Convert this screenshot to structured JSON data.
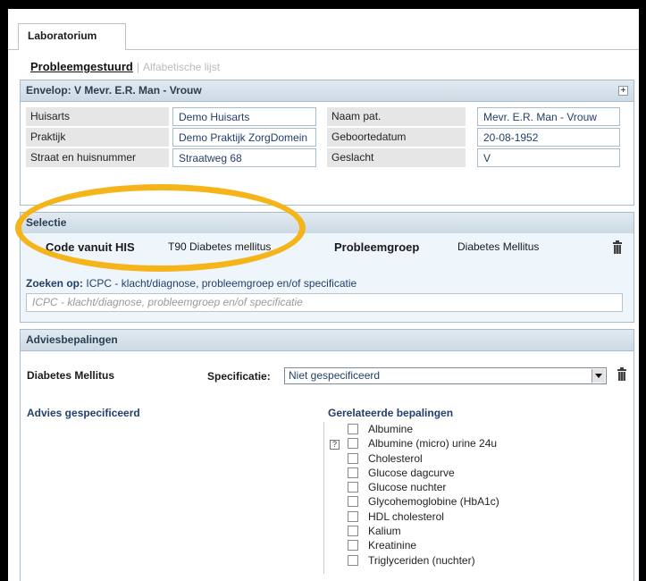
{
  "tab": {
    "label": "Laboratorium"
  },
  "subnav": {
    "active": "Probleemgestuurd",
    "separator": "|",
    "inactive": "Alfabetische lijst"
  },
  "envelop": {
    "title": "Envelop: V Mevr. E.R. Man - Vrouw",
    "fields": [
      {
        "label": "Huisarts",
        "value": "Demo Huisarts"
      },
      {
        "label": "Praktijk",
        "value": "Demo Praktijk ZorgDomein"
      },
      {
        "label": "Straat en huisnummer",
        "value": "Straatweg 68"
      },
      {
        "label": "Naam pat.",
        "value": "Mevr. E.R. Man - Vrouw"
      },
      {
        "label": "Geboortedatum",
        "value": "20-08-1952"
      },
      {
        "label": "Geslacht",
        "value": "V"
      }
    ]
  },
  "selectie": {
    "title": "Selectie",
    "code_label": "Code vanuit HIS",
    "code_value": "T90 Diabetes mellitus",
    "groep_label": "Probleemgroep",
    "groep_value": "Diabetes Mellitus",
    "zoeken_prefix": "Zoeken op:",
    "zoeken_text": "ICPC - klacht/diagnose, probleemgroep en/of specificatie",
    "search_placeholder": "ICPC - klacht/diagnose, probleemgroep en/of specificatie"
  },
  "advies": {
    "title": "Adviesbepalingen",
    "group": "Diabetes Mellitus",
    "spec_label": "Specificatie:",
    "spec_value": "Niet gespecificeerd",
    "advies_heading": "Advies gespecificeerd",
    "gerel_heading": "Gerelateerde bepalingen",
    "help_glyph": "?",
    "items": [
      "Albumine",
      "Albumine (micro) urine 24u",
      "Cholesterol",
      "Glucose dagcurve",
      "Glucose nuchter",
      "Glycohemoglobine (HbA1c)",
      "HDL cholesterol",
      "Kalium",
      "Kreatinine",
      "Triglyceriden (nuchter)"
    ]
  },
  "colors": {
    "highlight": "#f4b41a",
    "header_text": "#2c3e50",
    "value_text": "#23406a"
  }
}
